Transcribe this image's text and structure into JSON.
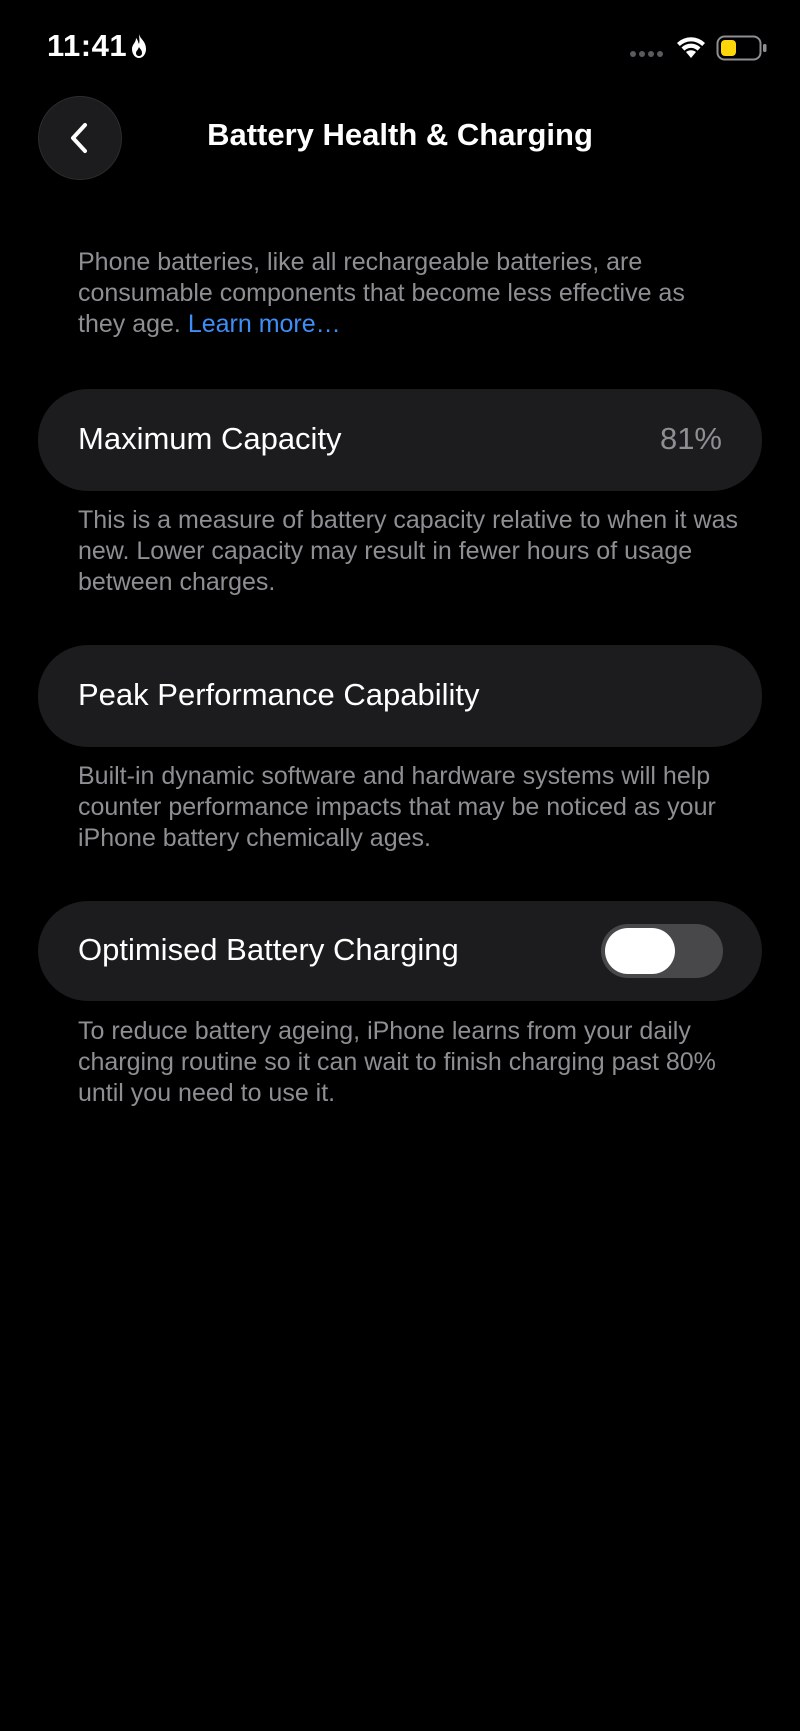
{
  "status_bar": {
    "time": "11:41",
    "focus_icon": "flame-icon",
    "signal_icon": "signal-dots-icon",
    "wifi_icon": "wifi-icon",
    "battery_icon": "battery-icon",
    "battery_color": "#ffd60a"
  },
  "nav": {
    "back_icon": "chevron-left-icon",
    "title": "Battery Health & Charging"
  },
  "intro": {
    "text": "Phone batteries, like all rechargeable batteries, are consumable components that become less effective as they age. ",
    "link_label": "Learn more…",
    "link_color": "#3e8ef7"
  },
  "maximum_capacity": {
    "label": "Maximum Capacity",
    "value": "81%",
    "footnote": "This is a measure of battery capacity relative to when it was new. Lower capacity may result in fewer hours of usage between charges."
  },
  "peak_performance": {
    "label": "Peak Performance Capability",
    "footnote": "Built-in dynamic software and hardware systems will help counter performance impacts that may be noticed as your iPhone battery chemically ages."
  },
  "optimised_charging": {
    "label": "Optimised Battery Charging",
    "toggle_on": false,
    "footnote": "To reduce battery ageing, iPhone learns from your daily charging routine so it can wait to finish charging past 80% until you need to use it."
  },
  "colors": {
    "background": "#000000",
    "card": "#1c1c1e",
    "secondary_text": "#8e8e93",
    "toggle_track_off": "#48484a"
  }
}
